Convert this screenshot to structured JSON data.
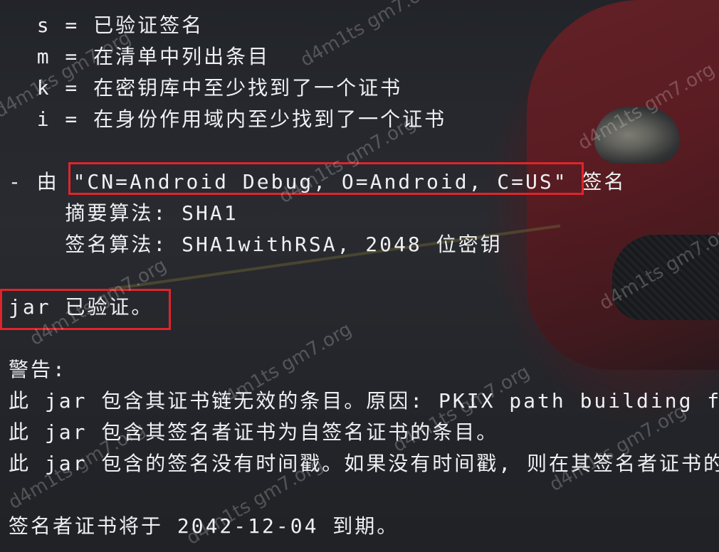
{
  "terminal": {
    "legend": {
      "s": "  s = 已验证签名",
      "m": "  m = 在清单中列出条目",
      "k": "  k = 在密钥库中至少找到了一个证书",
      "i": "  i = 在身份作用域内至少找到了一个证书"
    },
    "signer": {
      "prefix": "- 由 ",
      "dn": "\"CN=Android Debug, O=Android, C=US\"",
      "suffix": " 签名",
      "digest": "    摘要算法: SHA1",
      "sigalg": "    签名算法: SHA1withRSA, 2048 位密钥"
    },
    "verified": "jar 已验证。",
    "warning": {
      "title": "警告:",
      "line1": "此 jar 包含其证书链无效的条目。原因: PKIX path building failed",
      "line2": "此 jar 包含其签名者证书为自签名证书的条目。",
      "line3": "此 jar 包含的签名没有时间戳。如果没有时间戳, 则在其签名者证书的到期日期"
    },
    "expiry": "签名者证书将于 2042-12-04 到期。"
  },
  "colors": {
    "text": "#eef0f2",
    "highlight_border": "#e0242b"
  },
  "watermark": "d4m1ts gm7.org"
}
